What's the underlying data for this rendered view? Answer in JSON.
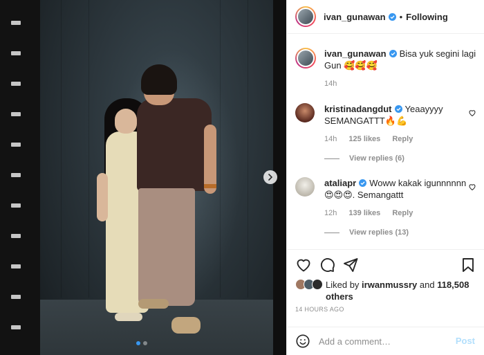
{
  "header": {
    "username": "ivan_gunawan",
    "separator": "•",
    "follow_label": "Following"
  },
  "caption": {
    "username": "ivan_gunawan",
    "text": "Bisa yuk segini lagi Gun 🥰🥰🥰",
    "time": "14h"
  },
  "comments": [
    {
      "username": "kristinadangdut",
      "text": "Yeaayyyy SEMANGATTT🔥💪",
      "time": "14h",
      "likes": "125 likes",
      "reply_label": "Reply",
      "view_replies": "View replies (6)"
    },
    {
      "username": "ataliapr",
      "text": "Woww kakak igunnnnnn 😍😍😍. Semangattt",
      "time": "12h",
      "likes": "139 likes",
      "reply_label": "Reply",
      "view_replies": "View replies (13)"
    }
  ],
  "likes": {
    "prefix": "Liked by",
    "user": "irwanmussry",
    "and": "and",
    "others": "118,508 others"
  },
  "timestamp": "14 HOURS AGO",
  "add_comment": {
    "placeholder": "Add a comment…",
    "post_label": "Post"
  },
  "icons": [
    "verified-badge-icon",
    "heart-icon",
    "comment-icon",
    "share-icon",
    "bookmark-icon",
    "emoji-icon",
    "chevron-right-icon"
  ],
  "colors": {
    "accent": "#3897f0",
    "verified": "#3897f0",
    "post_disabled": "#b2dffc"
  }
}
